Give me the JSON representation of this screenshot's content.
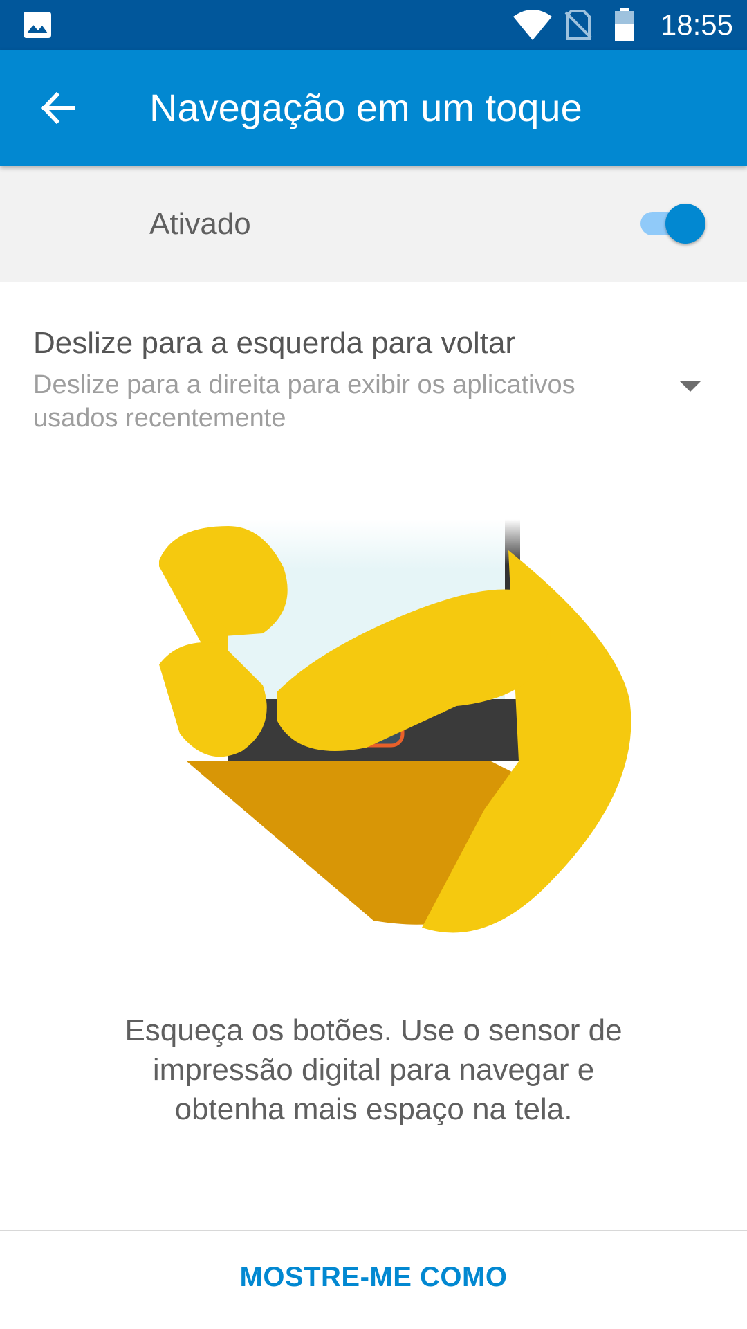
{
  "status_bar": {
    "time": "18:55",
    "icons": [
      "gallery-icon",
      "wifi-icon",
      "no-sim-icon",
      "battery-icon"
    ]
  },
  "app_bar": {
    "title": "Navegação em um toque",
    "back_icon": "arrow-back-icon"
  },
  "master_switch": {
    "label": "Ativado",
    "state": "on"
  },
  "gesture_setting": {
    "primary": "Deslize para a esquerda para voltar",
    "secondary": "Deslize para a direita para exibir os aplicativos usados recentemente",
    "dropdown_icon": "dropdown-arrow-icon"
  },
  "illustration": {
    "subject": "hand-swiping-fingerprint-sensor"
  },
  "description": "Esqueça os botões. Use o sensor de impressão digital para navegar e obtenha mais espaço na tela.",
  "action_button": {
    "label": "MOSTRE-ME COMO"
  },
  "colors": {
    "status_bar": "#01579B",
    "app_bar": "#0288D1",
    "accent": "#0288D1",
    "hand": "#F5C90F",
    "hand_shadow": "#D89606"
  }
}
